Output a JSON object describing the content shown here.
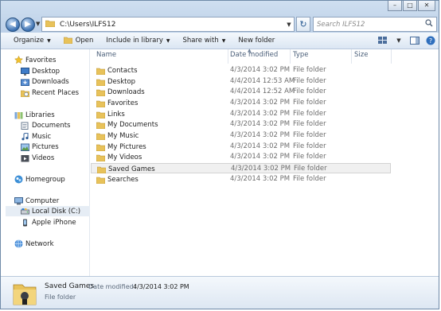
{
  "window": {
    "address": "C:\\Users\\ILFS12",
    "search_placeholder": "Search ILFS12",
    "caption": {
      "minimize": "–",
      "maximize": "□",
      "close": "✕"
    }
  },
  "toolbar": {
    "organize": "Organize",
    "open": "Open",
    "include_in_library": "Include in library",
    "share_with": "Share with",
    "new_folder": "New folder"
  },
  "nav": {
    "favorites": "Favorites",
    "desktop": "Desktop",
    "downloads": "Downloads",
    "recent_places": "Recent Places",
    "libraries": "Libraries",
    "documents": "Documents",
    "music": "Music",
    "pictures": "Pictures",
    "videos": "Videos",
    "homegroup": "Homegroup",
    "computer": "Computer",
    "local_disk": "Local Disk (C:)",
    "apple_iphone": "Apple iPhone",
    "network": "Network"
  },
  "columns": {
    "name": "Name",
    "date_modified": "Date modified",
    "type": "Type",
    "size": "Size"
  },
  "files": [
    {
      "name": "Contacts",
      "date": "4/3/2014 3:02 PM",
      "type": "File folder"
    },
    {
      "name": "Desktop",
      "date": "4/4/2014 12:53 AM",
      "type": "File folder"
    },
    {
      "name": "Downloads",
      "date": "4/4/2014 12:52 AM",
      "type": "File folder"
    },
    {
      "name": "Favorites",
      "date": "4/3/2014 3:02 PM",
      "type": "File folder"
    },
    {
      "name": "Links",
      "date": "4/3/2014 3:02 PM",
      "type": "File folder"
    },
    {
      "name": "My Documents",
      "date": "4/3/2014 3:02 PM",
      "type": "File folder"
    },
    {
      "name": "My Music",
      "date": "4/3/2014 3:02 PM",
      "type": "File folder"
    },
    {
      "name": "My Pictures",
      "date": "4/3/2014 3:02 PM",
      "type": "File folder"
    },
    {
      "name": "My Videos",
      "date": "4/3/2014 3:02 PM",
      "type": "File folder"
    },
    {
      "name": "Saved Games",
      "date": "4/3/2014 3:02 PM",
      "type": "File folder"
    },
    {
      "name": "Searches",
      "date": "4/3/2014 3:02 PM",
      "type": "File folder"
    }
  ],
  "details": {
    "name": "Saved Games",
    "date_label": "Date modified:",
    "date_value": "4/3/2014 3:02 PM",
    "type": "File folder"
  },
  "colors": {
    "folder": "#e8c25a",
    "accent": "#3a6fb0"
  }
}
